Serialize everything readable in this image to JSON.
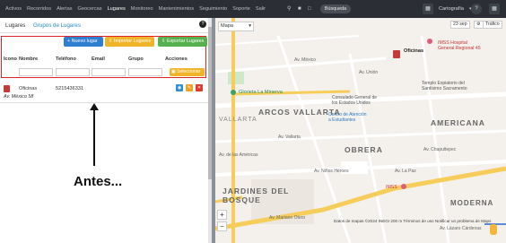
{
  "nav": {
    "items": [
      "Activos",
      "Recorridos",
      "Alertas",
      "Geocercas",
      "Lugares",
      "Monitoreo",
      "Mantenimientos",
      "Seguimiento",
      "Soporte",
      "Salir"
    ],
    "active": "Lugares",
    "search_label": "Búsqueda",
    "cartography_label": "Cartografía"
  },
  "tabs": {
    "lugares": "Lugares",
    "grupos": "Grupos de Lugares"
  },
  "toolbar": {
    "new_label": "Nuevo lugar",
    "import_label": "Importar Lugares",
    "export_label": "Exportar Lugares"
  },
  "table": {
    "headers": [
      "Icono",
      "Nombre",
      "Teléfono",
      "Email",
      "Grupo",
      "Acciones"
    ],
    "select_label": "Seleccionar",
    "rows": [
      {
        "name": "Oficinas",
        "phone": "5215436331",
        "address": "Av. México 58"
      }
    ]
  },
  "annotation": "Antes...",
  "map": {
    "type_label": "Mapa",
    "box_23": "23 sep",
    "box_traffic": "Tráfico",
    "labels": {
      "imss_hospital": "IMSS Hospital\nGeneral Regional 45",
      "oficinas": "Oficinas",
      "glorieta": "Glorieta La Minerva",
      "templo": "Templo Expiatorio del\nSantísimo Sacramento",
      "consulado": "Consulado General de\nlos Estados Unidos",
      "centro": "Centro de Atención\na Estudiantes",
      "imss2": "IMSS",
      "arcos": "ARCOS VALLARTA",
      "americana": "AMERICANA",
      "obrera": "OBRERA",
      "jardines": "JARDINES DEL\nBOSQUE",
      "moderna": "MODERNA",
      "vallarta": "VALLARTA",
      "av_mexico": "Av. México",
      "av_vallarta": "Av. Vallarta",
      "av_niños": "Av. Niños Héroes",
      "av_mariano": "Av. Mariano Otero",
      "av_la_paz": "Av. La Paz",
      "av_americas": "Av. de las Américas",
      "av_chapultepec": "Av. Chapultepec",
      "av_union": "Av. Unión",
      "av_lazaro": "Av. Lázaro Cárdenas"
    },
    "footer": "Datos de mapas ©2024 INEGI   200 m   Términos de uso   Notificar un problema de Maps"
  }
}
